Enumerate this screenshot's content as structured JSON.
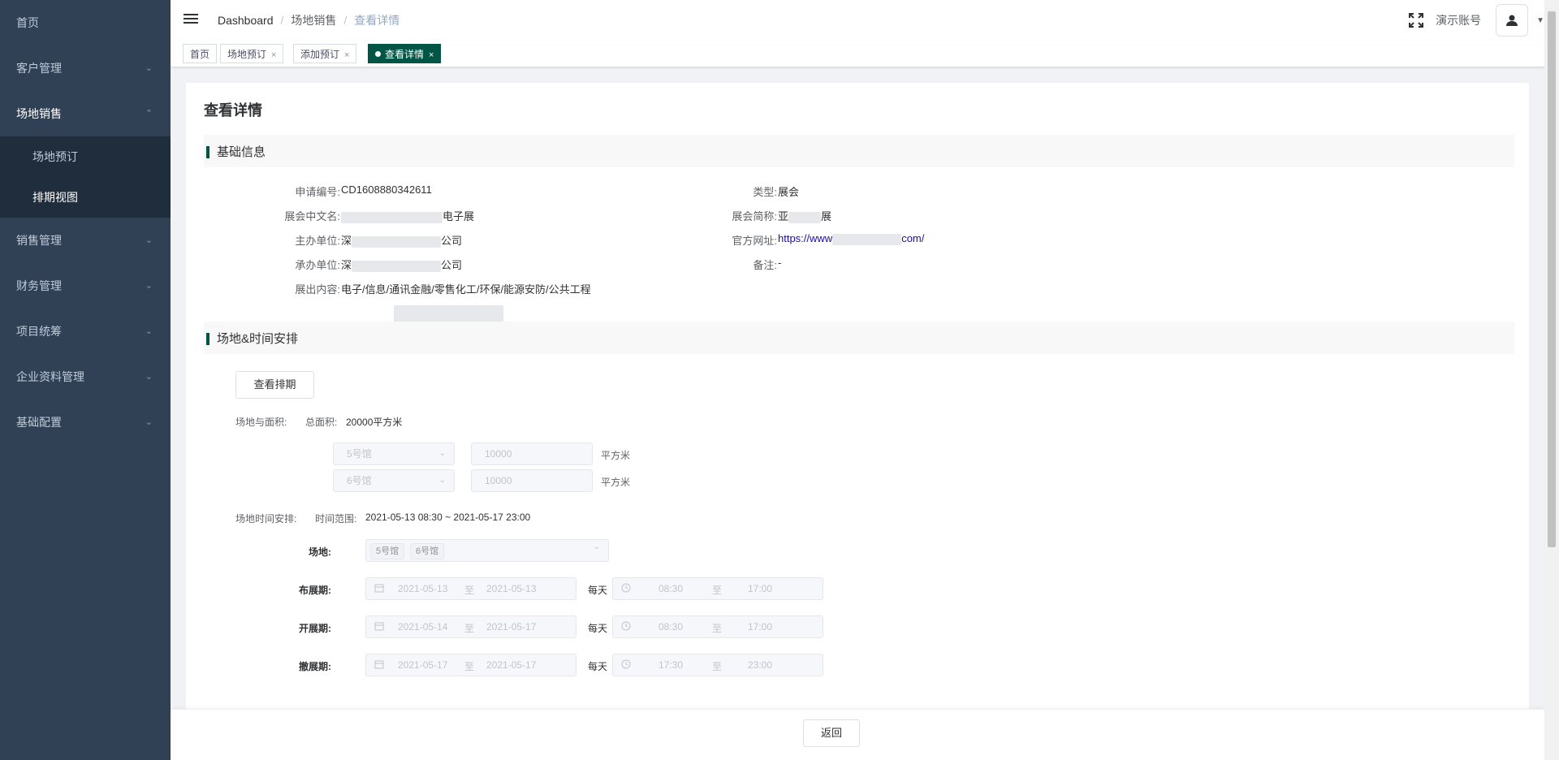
{
  "sidebar": {
    "items": [
      {
        "label": "首页",
        "has_arrow": false
      },
      {
        "label": "客户管理",
        "has_arrow": true
      },
      {
        "label": "场地销售",
        "has_arrow": true,
        "open": true
      },
      {
        "label": "销售管理",
        "has_arrow": true
      },
      {
        "label": "财务管理",
        "has_arrow": true
      },
      {
        "label": "项目统筹",
        "has_arrow": true
      },
      {
        "label": "企业资料管理",
        "has_arrow": true
      },
      {
        "label": "基础配置",
        "has_arrow": true
      }
    ],
    "submenu": [
      "场地预订",
      "排期视图"
    ]
  },
  "navbar": {
    "breadcrumb": [
      "Dashboard",
      "场地销售",
      "查看详情"
    ],
    "account": "演示账号"
  },
  "tags": [
    {
      "label": "首页",
      "closable": false,
      "active": false
    },
    {
      "label": "场地预订",
      "closable": true,
      "active": false
    },
    {
      "label": "添加预订",
      "closable": true,
      "active": false
    },
    {
      "label": "查看详情",
      "closable": true,
      "active": true
    }
  ],
  "page": {
    "title": "查看详情",
    "basic_section": "基础信息",
    "basic_left": [
      {
        "label": "申请编号:",
        "value": "CD1608880342611"
      },
      {
        "label": "展会中文名:",
        "value_suffix": "电子展"
      },
      {
        "label": "主办单位:",
        "value_prefix": "深",
        "value_suffix": "公司"
      },
      {
        "label": "承办单位:",
        "value_prefix": "深",
        "value_suffix": "公司"
      },
      {
        "label": "展出内容:",
        "value": "电子/信息/通讯金融/零售化工/环保/能源安防/公共工程"
      }
    ],
    "basic_right": [
      {
        "label": "类型:",
        "value": "展会"
      },
      {
        "label": "展会简称:",
        "value_prefix": "亚",
        "value_suffix": "展"
      },
      {
        "label": "官方网址:",
        "value_prefix": "https://www",
        "value_suffix": "com/"
      },
      {
        "label": "备注:",
        "value": "-"
      }
    ],
    "venue_section": "场地&时间安排",
    "view_schedule_btn": "查看排期",
    "area_label": "场地与面积:",
    "total_area_label": "总面积:",
    "total_area_value": "20000平方米",
    "halls": [
      {
        "hall": "5号馆",
        "area": "10000",
        "unit": "平方米"
      },
      {
        "hall": "6号馆",
        "area": "10000",
        "unit": "平方米"
      }
    ],
    "time_label": "场地时间安排:",
    "time_range_label": "时间范围:",
    "time_range_value": "2021-05-13 08:30 ~ 2021-05-17 23:00",
    "venue_label": "场地:",
    "venue_tags": [
      "5号馆",
      "6号馆"
    ],
    "periods": [
      {
        "label": "布展期:",
        "start": "2021-05-13",
        "end": "2021-05-13",
        "every": "每天",
        "t_start": "08:30",
        "t_end": "17:00"
      },
      {
        "label": "开展期:",
        "start": "2021-05-14",
        "end": "2021-05-17",
        "every": "每天",
        "t_start": "08:30",
        "t_end": "17:00"
      },
      {
        "label": "撤展期:",
        "start": "2021-05-17",
        "end": "2021-05-17",
        "every": "每天",
        "t_start": "17:30",
        "t_end": "23:00"
      }
    ],
    "to_label": "至"
  },
  "footer": {
    "back_label": "返回"
  },
  "colors": {
    "sidebar_bg": "#304156",
    "accent": "#005545",
    "link": "#1a0dab"
  }
}
